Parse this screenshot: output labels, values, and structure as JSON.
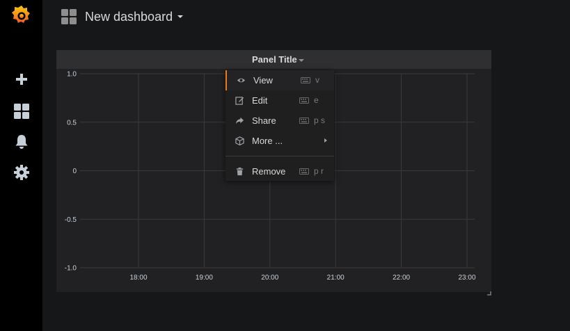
{
  "colors": {
    "sidebar_bg": "#000000",
    "page_bg": "#161719",
    "panel_bg": "#212124",
    "panel_header_bg": "#2f2f32",
    "grid": "#3a3a3d",
    "text": "#d8d9da",
    "accent": "#eb7b18"
  },
  "sidebar": {
    "logo": "grafana-logo-icon",
    "items": [
      {
        "icon": "plus-icon"
      },
      {
        "icon": "dashboards-icon"
      },
      {
        "icon": "bell-icon"
      },
      {
        "icon": "gear-icon"
      }
    ]
  },
  "header": {
    "icon": "dashboard-grid-icon",
    "title": "New dashboard"
  },
  "panel": {
    "title": "Panel Title"
  },
  "chart_data": {
    "type": "line",
    "title": "",
    "x": [
      "18:00",
      "19:00",
      "20:00",
      "21:00",
      "22:00",
      "23:00"
    ],
    "y_ticks": [
      "1.0",
      "0.5",
      "0",
      "-0.5",
      "-1.0"
    ],
    "ylim": [
      -1.0,
      1.0
    ],
    "grid": true,
    "series": []
  },
  "context_menu": {
    "items": [
      {
        "label": "View",
        "icon": "eye-icon",
        "shortcut": "v",
        "keyboard_icon": "keyboard-icon"
      },
      {
        "label": "Edit",
        "icon": "edit-icon",
        "shortcut": "e",
        "keyboard_icon": "keyboard-icon"
      },
      {
        "label": "Share",
        "icon": "share-icon",
        "shortcut": "p s",
        "keyboard_icon": "keyboard-icon"
      },
      {
        "label": "More ...",
        "icon": "cube-icon",
        "submenu": true
      }
    ],
    "danger_item": {
      "label": "Remove",
      "icon": "trash-icon",
      "shortcut": "p r",
      "keyboard_icon": "keyboard-icon"
    }
  }
}
